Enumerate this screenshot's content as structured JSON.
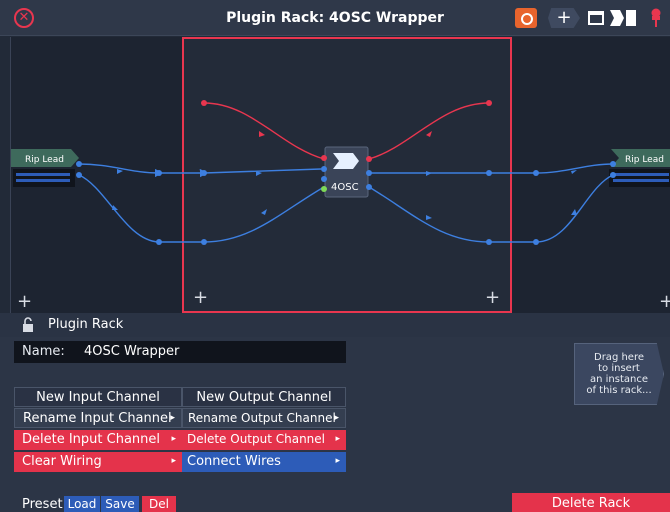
{
  "window": {
    "title": "Plugin Rack: 4OSC Wrapper",
    "close_glyph": "✕",
    "add_glyph": "+",
    "icons": [
      "close-icon",
      "power-icon",
      "add-icon",
      "layout-icon",
      "route-icon",
      "pin-icon"
    ]
  },
  "canvas": {
    "input_node": "Rip Lead",
    "output_node": "Rip Lead",
    "plugin_node": "4OSC",
    "plus_glyph": "+",
    "colors": {
      "red_wire": "#e8364f",
      "blue_wire": "#3d7fe0",
      "frame": "#e8364f"
    }
  },
  "panel": {
    "title": "Plugin Rack",
    "name_label": "Name:",
    "name_value": "4OSC Wrapper",
    "drag_hint": [
      "Drag here",
      "to insert",
      "an instance",
      "of this rack..."
    ],
    "new_input_channel": "New Input Channel",
    "new_output_channel": "New Output Channel",
    "rename_input_channel": "Rename Input Channel",
    "rename_output_channel": "Rename Output Channel",
    "delete_input_channel": "Delete Input Channel",
    "delete_output_channel": "Delete Output Channel",
    "clear_wiring": "Clear Wiring",
    "connect_wires": "Connect Wires",
    "submenu_arrow": "▸",
    "preset_label": "Preset",
    "load": "Load",
    "save": "Save",
    "del": "Del",
    "delete_rack": "Delete Rack"
  }
}
